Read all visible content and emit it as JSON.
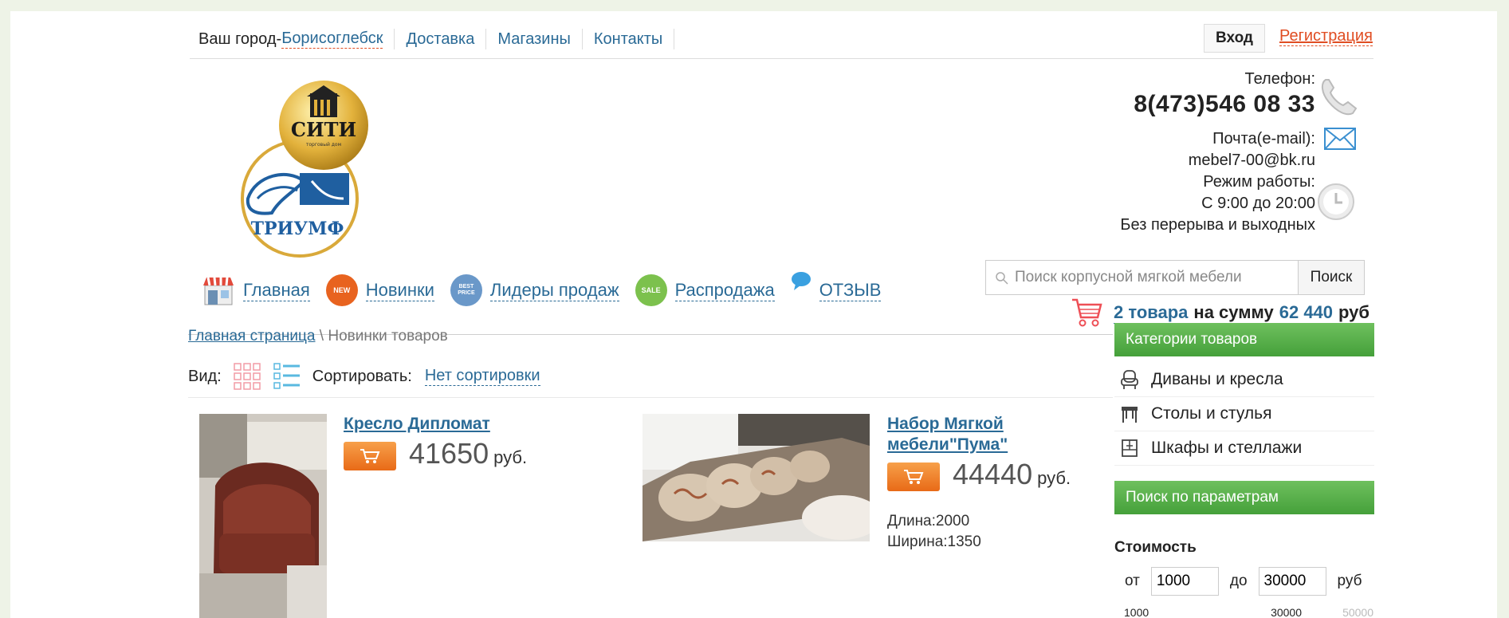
{
  "topbar": {
    "city_label": "Ваш город-",
    "city": "Борисоглебск",
    "links": [
      "Доставка",
      "Магазины",
      "Контакты"
    ],
    "login": "Вход",
    "register": "Регистрация"
  },
  "logo": {
    "top_text": "СИТИ",
    "top_small": "торговый дом",
    "bottom_text": "ТРИУМФ"
  },
  "contacts": {
    "phone_label": "Телефон:",
    "phone": "8(473)546 08 33",
    "email_label": "Почта(e-mail):",
    "email": "mebel7-00@bk.ru",
    "hours_label": "Режим работы:",
    "hours": "С 9:00 до 20:00",
    "hours_note": "Без перерыва и выходных"
  },
  "nav": {
    "items": [
      {
        "label": "Главная",
        "icon": "store-icon"
      },
      {
        "label": "Новинки",
        "icon": "new-badge-icon",
        "badge": "NEW",
        "color": "#e8631f"
      },
      {
        "label": "Лидеры продаж",
        "icon": "best-price-badge-icon",
        "badge": "BEST PRICE",
        "color": "#6a98c9"
      },
      {
        "label": "Распродажа",
        "icon": "sale-badge-icon",
        "badge": "SALE",
        "color": "#7cc14d"
      },
      {
        "label": "ОТЗЫВ",
        "icon": "speech-bubble-icon"
      }
    ]
  },
  "search": {
    "placeholder": "Поиск корпусной мягкой мебели",
    "button": "Поиск"
  },
  "cart": {
    "count_text": "2 товара",
    "sum_label": "на сумму",
    "sum": "62 440",
    "currency": "руб"
  },
  "breadcrumb": {
    "home": "Главная страница",
    "separator": " \\ ",
    "current": "Новинки товаров"
  },
  "viewbar": {
    "view_label": "Вид:",
    "sort_label": "Сортировать:",
    "sort_value": "Нет сортировки"
  },
  "products": [
    {
      "title": "Кресло Дипломат",
      "price": "41650",
      "currency": "руб."
    },
    {
      "title": "Набор Мягкой мебели\"Пума\"",
      "price": "44440",
      "currency": "руб.",
      "specs": [
        "Длина:2000",
        "Ширина:1350"
      ]
    }
  ],
  "sidebar": {
    "categories_title": "Категории товаров",
    "categories": [
      {
        "label": "Диваны и кресла",
        "icon": "armchair-icon"
      },
      {
        "label": "Столы и стулья",
        "icon": "table-icon"
      },
      {
        "label": "Шкафы и стеллажи",
        "icon": "wardrobe-icon"
      }
    ],
    "filter_title": "Поиск по параметрам",
    "price_label": "Стоимость",
    "from_label": "от",
    "from_value": "1000",
    "to_label": "до",
    "to_value": "30000",
    "currency": "руб",
    "slider_min": "1000",
    "slider_cur": "30000",
    "slider_max": "50000"
  },
  "colors": {
    "link": "#2a6a96",
    "accent": "#e04d22",
    "green": "#5cb14a",
    "buy": "#ee7a22"
  }
}
